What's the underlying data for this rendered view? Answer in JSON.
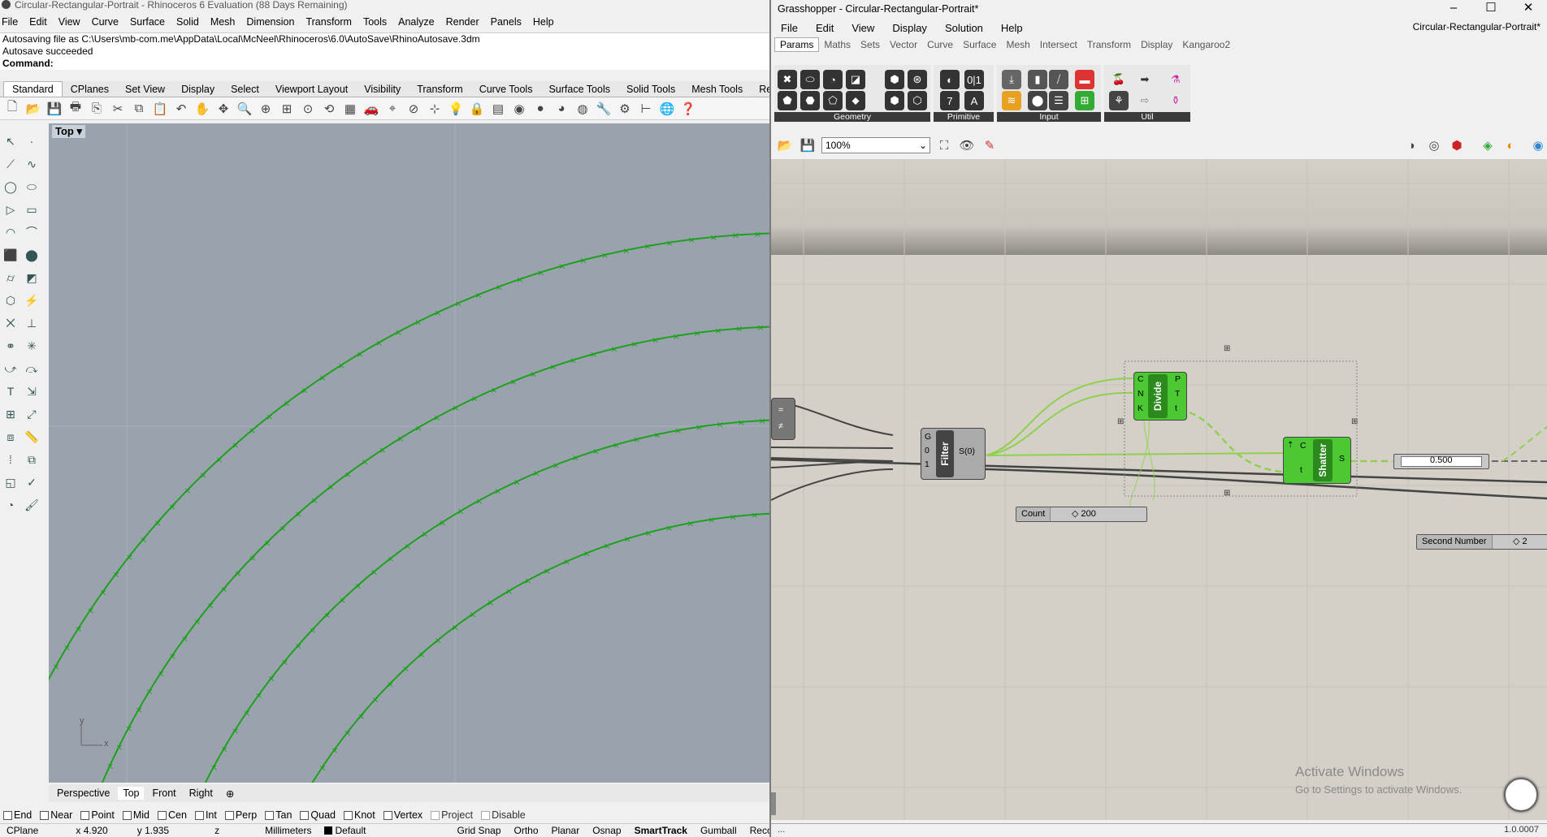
{
  "rhino": {
    "title": "Circular-Rectangular-Portrait - Rhinoceros 6 Evaluation (88 Days Remaining)",
    "menu": [
      "File",
      "Edit",
      "View",
      "Curve",
      "Surface",
      "Solid",
      "Mesh",
      "Dimension",
      "Transform",
      "Tools",
      "Analyze",
      "Render",
      "Panels",
      "Help"
    ],
    "history": [
      "Autosaving file as C:\\Users\\mb-com.me\\AppData\\Local\\McNeel\\Rhinoceros\\6.0\\AutoSave\\RhinoAutosave.3dm",
      "Autosave succeeded"
    ],
    "command_label": "Command:",
    "toolbar_tabs": [
      "Standard",
      "CPlanes",
      "Set View",
      "Display",
      "Select",
      "Viewport Layout",
      "Visibility",
      "Transform",
      "Curve Tools",
      "Surface Tools",
      "Solid Tools",
      "Mesh Tools",
      "Render To"
    ],
    "viewport_label": "Top",
    "axis_y": "y",
    "axis_x": "x",
    "view_tabs": [
      "Perspective",
      "Top",
      "Front",
      "Right"
    ],
    "osnaps": [
      {
        "label": "End",
        "checked": false
      },
      {
        "label": "Near",
        "checked": false
      },
      {
        "label": "Point",
        "checked": false
      },
      {
        "label": "Mid",
        "checked": false
      },
      {
        "label": "Cen",
        "checked": false
      },
      {
        "label": "Int",
        "checked": false
      },
      {
        "label": "Perp",
        "checked": false
      },
      {
        "label": "Tan",
        "checked": false
      },
      {
        "label": "Quad",
        "checked": false
      },
      {
        "label": "Knot",
        "checked": false
      },
      {
        "label": "Vertex",
        "checked": false
      },
      {
        "label": "Project",
        "checked": false
      },
      {
        "label": "Disable",
        "checked": false
      }
    ],
    "status": {
      "cplane": "CPlane",
      "x": "x 4.920",
      "y": "y 1.935",
      "z": "z",
      "units": "Millimeters",
      "layer": "Default",
      "toggles": [
        "Grid Snap",
        "Ortho",
        "Planar",
        "Osnap",
        "SmartTrack",
        "Gumball",
        "Record"
      ]
    },
    "curve_color": "#1ea01e"
  },
  "grasshopper": {
    "title": "Grasshopper - Circular-Rectangular-Portrait*",
    "doc_name": "Circular-Rectangular-Portrait*",
    "menu": [
      "File",
      "Edit",
      "View",
      "Display",
      "Solution",
      "Help"
    ],
    "tabs": [
      "Params",
      "Maths",
      "Sets",
      "Vector",
      "Curve",
      "Surface",
      "Mesh",
      "Intersect",
      "Transform",
      "Display",
      "Kangaroo2"
    ],
    "ribbon_groups": [
      "Geometry",
      "Primitive",
      "Input",
      "Util"
    ],
    "zoom": "100%",
    "components": {
      "filter": {
        "name": "Filter",
        "inputs": [
          "G",
          "0",
          "1"
        ],
        "output": "S(0)"
      },
      "divide": {
        "name": "Divide",
        "inputs": [
          "C",
          "N",
          "K"
        ],
        "outputs": [
          "P",
          "T",
          "t"
        ]
      },
      "shatter": {
        "name": "Shatter",
        "inputs": [
          "C",
          "t"
        ],
        "output": "S"
      }
    },
    "sliders": {
      "count": {
        "label": "Count",
        "value": "◇ 200"
      },
      "second": {
        "label": "Second Number",
        "value": "◇ 2"
      },
      "half": {
        "value": "0.500"
      }
    },
    "watermark": {
      "line1": "Activate Windows",
      "line2": "Go to Settings to activate Windows."
    },
    "version": "1.0.0007",
    "status_dots": "...",
    "wire_color": "#8fd14f",
    "component_color": "#4cc832"
  }
}
